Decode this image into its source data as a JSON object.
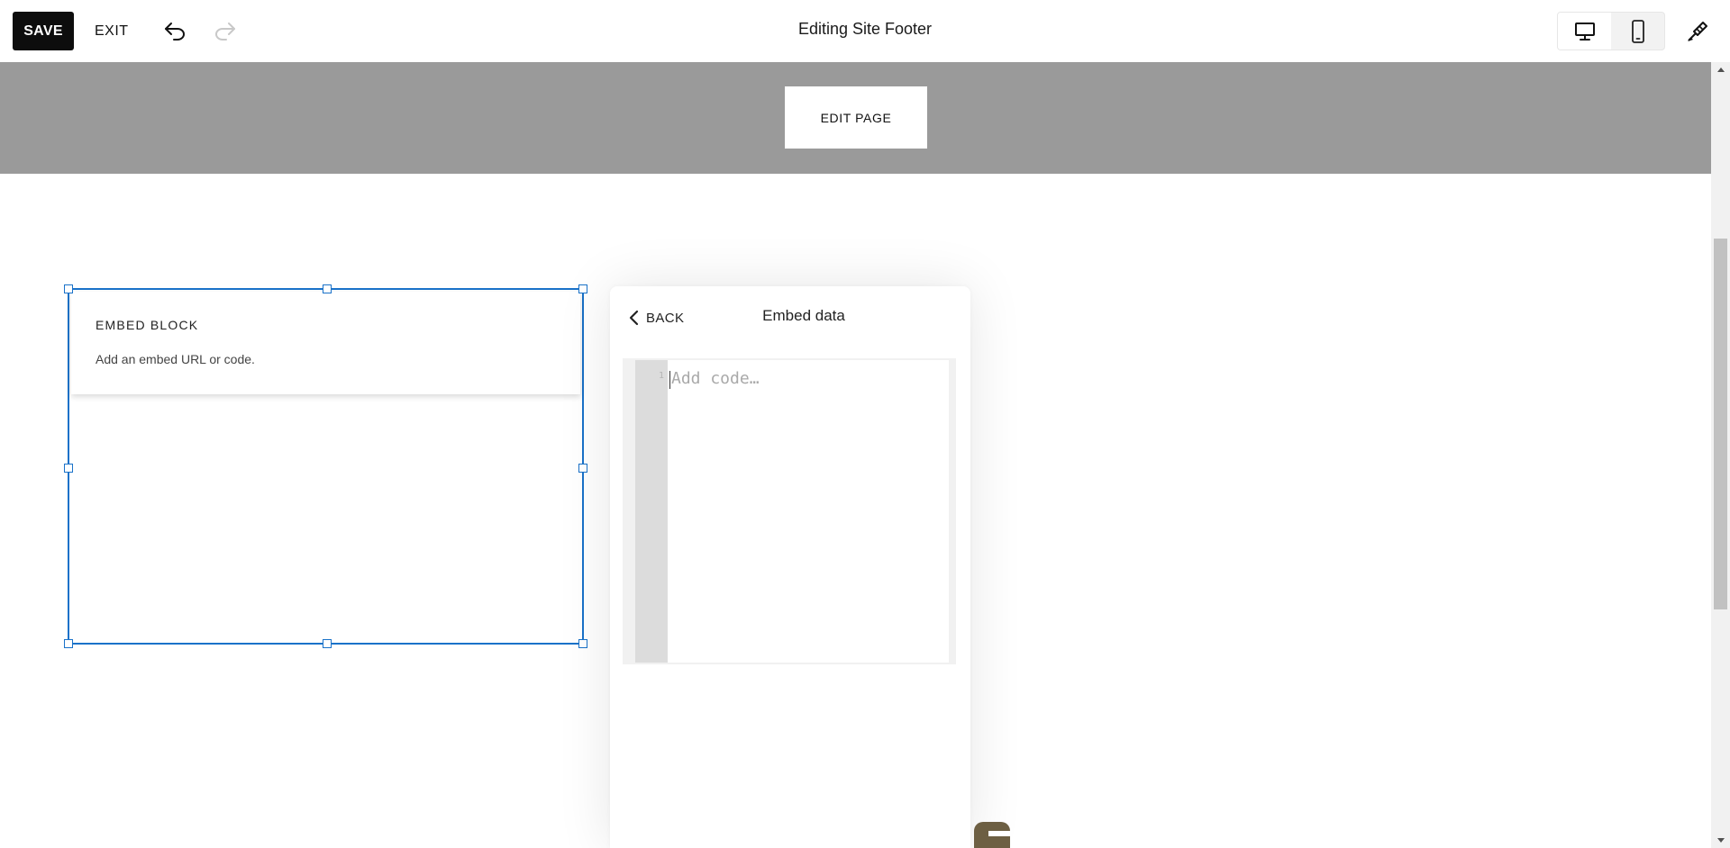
{
  "toolbar": {
    "save_label": "SAVE",
    "exit_label": "EXIT",
    "title": "Editing Site Footer",
    "undo_icon": "undo-icon",
    "redo_icon": "redo-icon",
    "desktop_icon": "desktop-icon",
    "mobile_icon": "mobile-icon",
    "design_icon": "paintbrush-icon"
  },
  "header_band": {
    "edit_page_label": "EDIT PAGE",
    "background": "#9a9a9a"
  },
  "embed_block": {
    "title": "EMBED BLOCK",
    "description": "Add an embed URL or code.",
    "selection_color": "#1a72c9"
  },
  "embed_panel": {
    "back_label": "BACK",
    "title": "Embed data",
    "code_editor": {
      "line_numbers": [
        "1"
      ],
      "placeholder": "Add code…",
      "value": ""
    }
  }
}
